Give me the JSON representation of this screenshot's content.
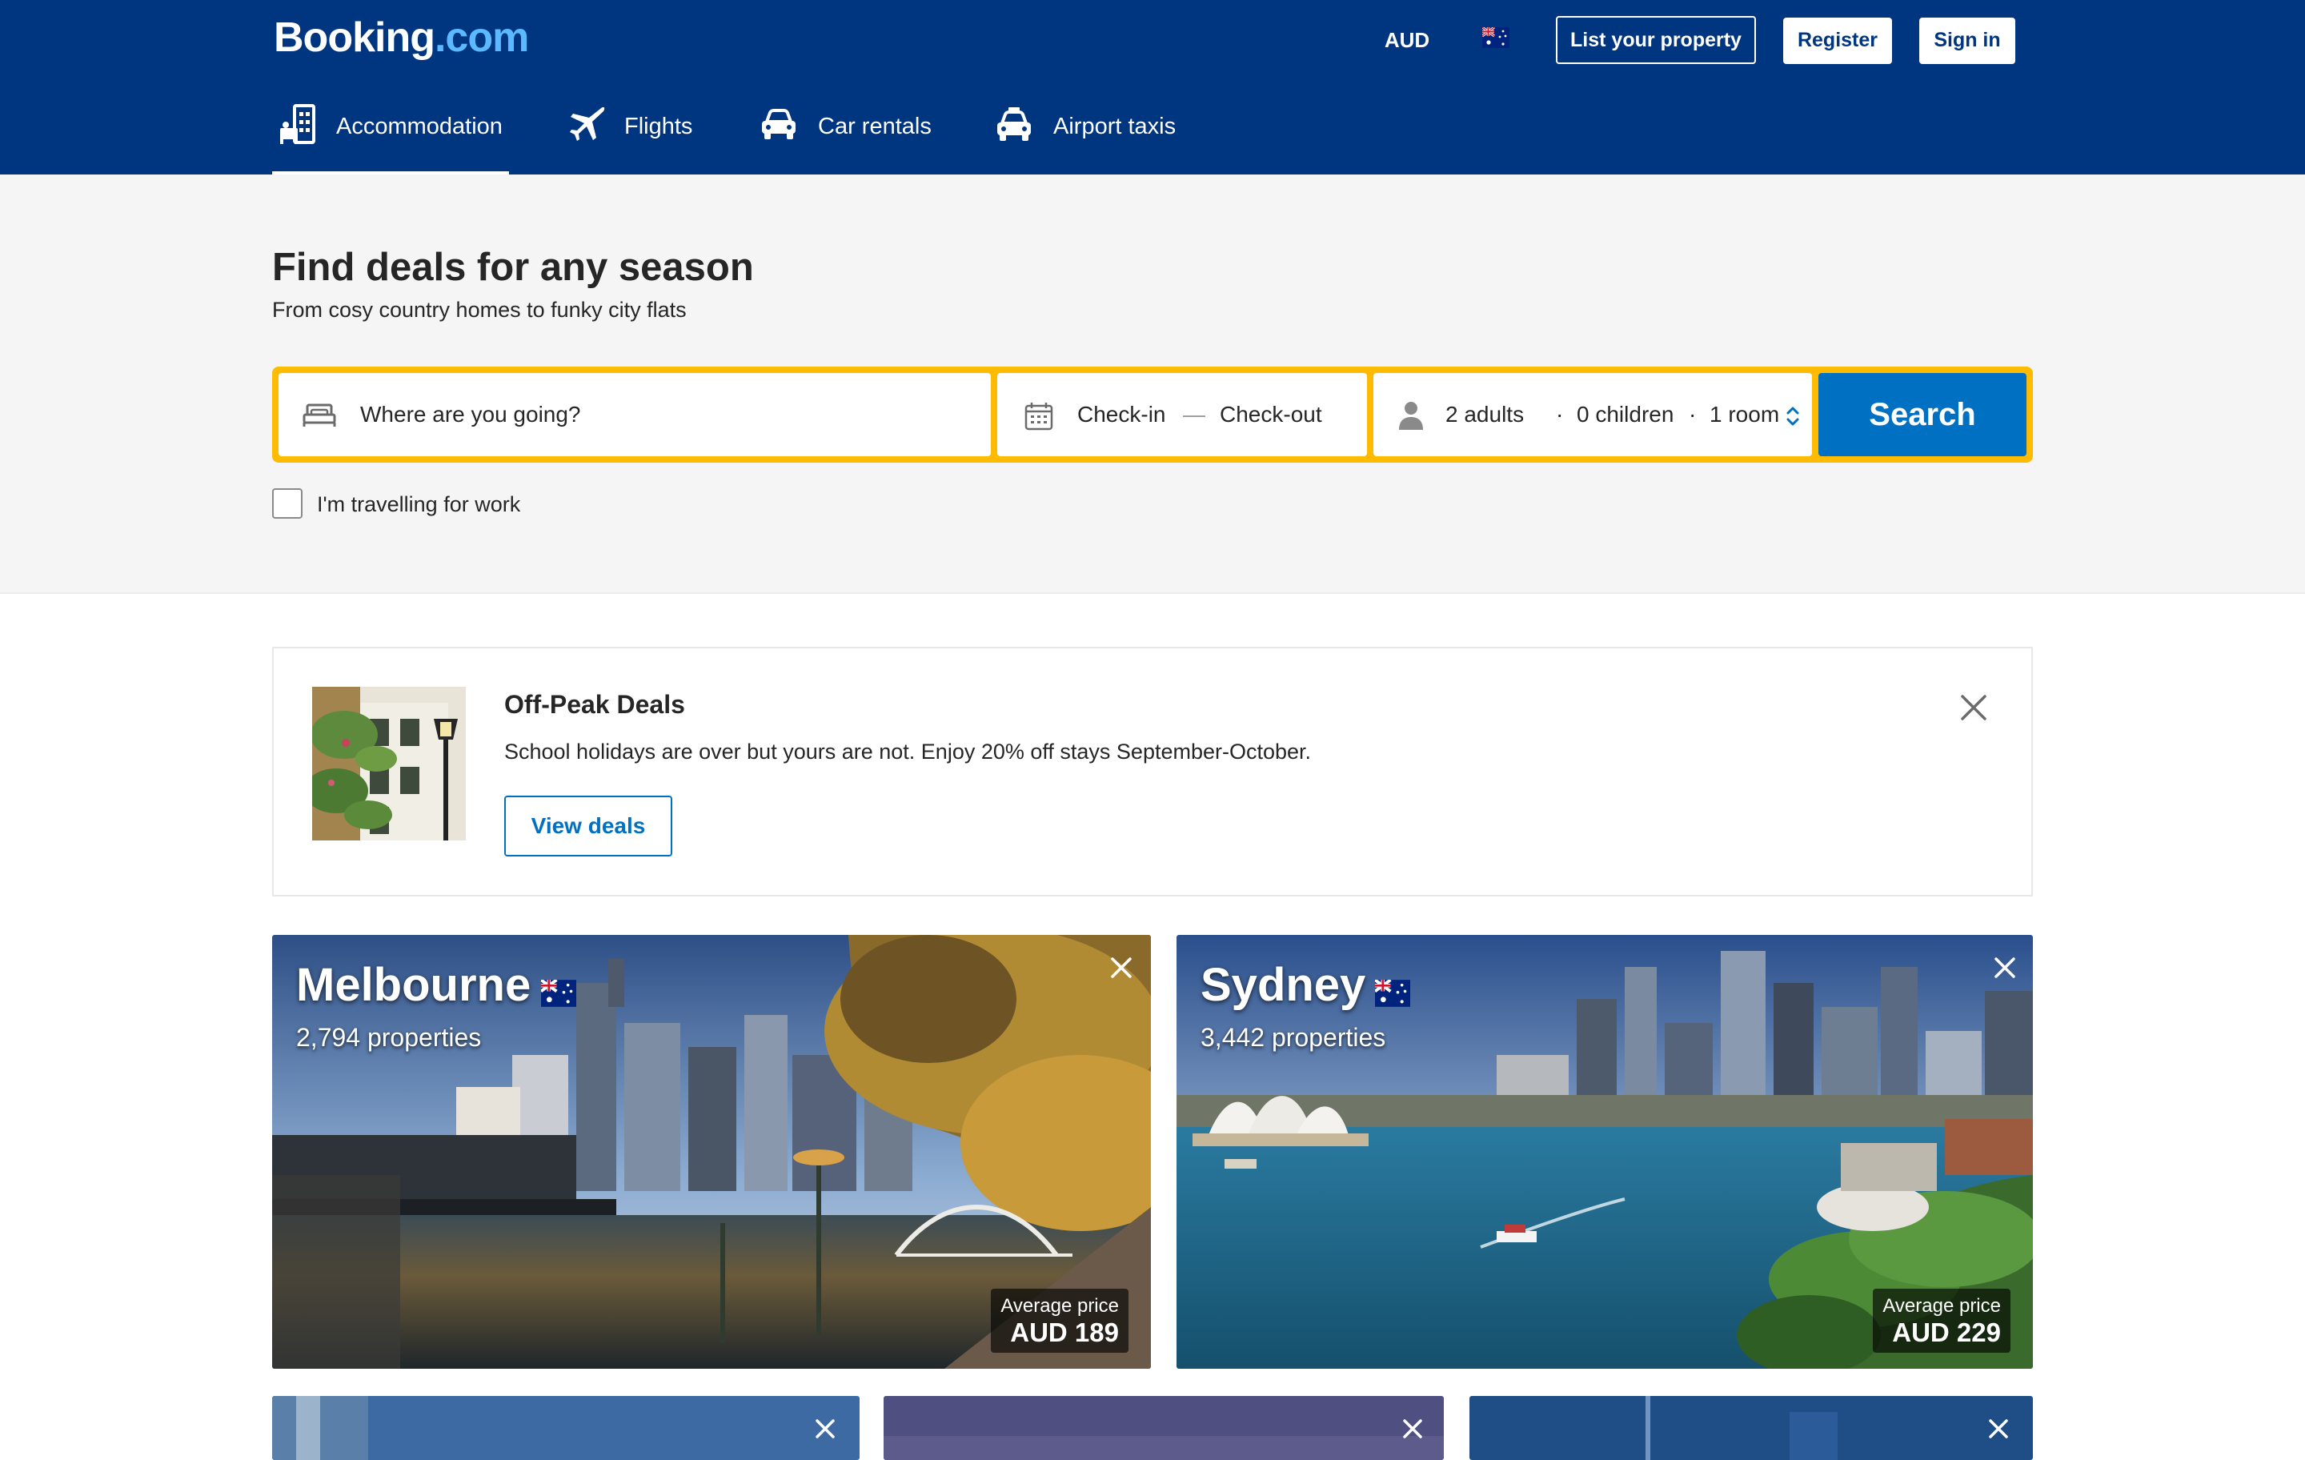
{
  "header": {
    "logo_main": "Booking",
    "logo_suffix": ".com",
    "currency": "AUD",
    "flag_icon": "australia-flag-icon",
    "list_property": "List your property",
    "register": "Register",
    "sign_in": "Sign in",
    "background_color": "#003580"
  },
  "nav": {
    "tabs": [
      {
        "label": "Accommodation",
        "icon": "bed-building-icon",
        "active": true
      },
      {
        "label": "Flights",
        "icon": "plane-icon"
      },
      {
        "label": "Car rentals",
        "icon": "car-icon"
      },
      {
        "label": "Airport taxis",
        "icon": "taxi-icon"
      }
    ]
  },
  "hero": {
    "title": "Find deals for any season",
    "subtitle": "From cosy country homes to funky city flats"
  },
  "search": {
    "destination_placeholder": "Where are you going?",
    "check_in": "Check-in",
    "dash": "—",
    "check_out": "Check-out",
    "adults": "2 adults",
    "dot": "·",
    "children": "0 children",
    "rooms": "1 room",
    "button": "Search",
    "work_label": "I'm travelling for work",
    "frame_color": "#febb02",
    "button_color": "#0071c2"
  },
  "promo": {
    "title": "Off-Peak Deals",
    "text": "School holidays are over but yours are not. Enjoy 20% off stays September-October.",
    "button": "View deals"
  },
  "cards": [
    {
      "city": "Melbourne",
      "properties": "2,794 properties",
      "price_label": "Average price",
      "price": "AUD 189"
    },
    {
      "city": "Sydney",
      "properties": "3,442 properties",
      "price_label": "Average price",
      "price": "AUD 229"
    }
  ]
}
